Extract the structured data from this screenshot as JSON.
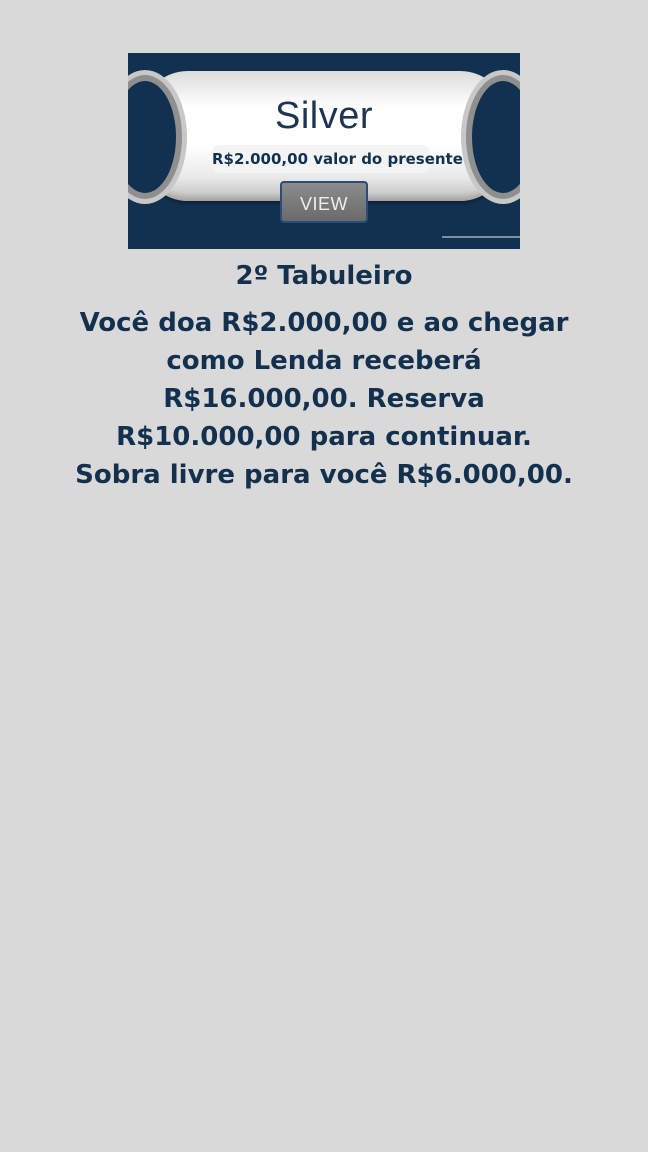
{
  "card": {
    "title": "Silver",
    "gift_value": "R$2.000,00 valor do presente",
    "view_label": "VIEW"
  },
  "content": {
    "board_title": "2º Tabuleiro",
    "description": "Você doa R$2.000,00 e ao chegar como Lenda receberá R$16.000,00. Reserva R$10.000,00 para continuar. Sobra livre para você R$6.000,00."
  },
  "colors": {
    "background": "#d9d9d9",
    "card_background": "#12304f",
    "text_primary": "#13304f",
    "button_gray": "#7a7a7a"
  }
}
